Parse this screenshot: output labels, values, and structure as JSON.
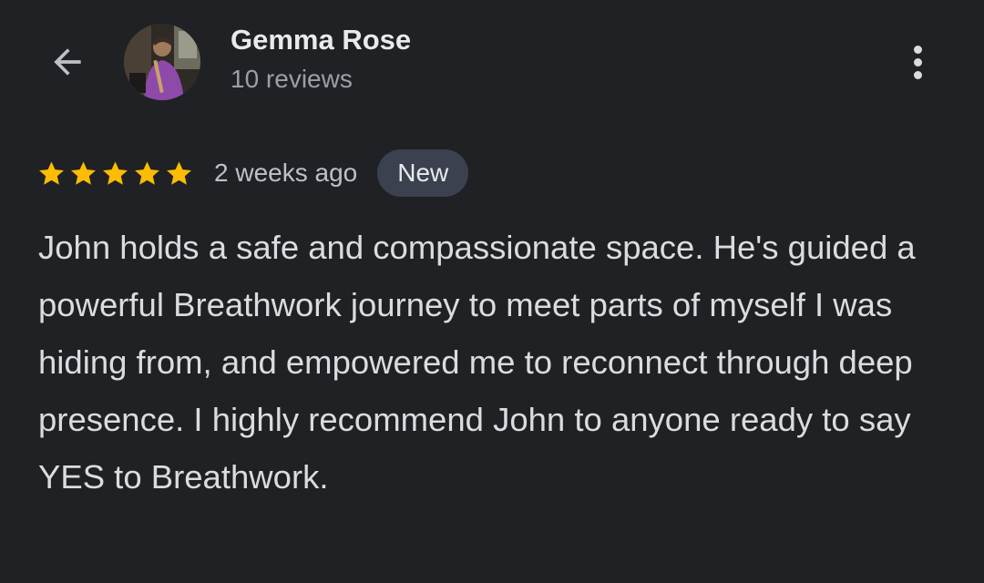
{
  "header": {
    "user_name": "Gemma Rose",
    "review_count": "10 reviews",
    "back_icon": "arrow-back-icon",
    "more_icon": "more-vert-icon"
  },
  "review": {
    "rating": 5,
    "max_rating": 5,
    "time_ago": "2 weeks ago",
    "badge": "New",
    "text": "John holds a safe and compassionate space. He's guided a powerful Breathwork journey to meet parts of myself I was hiding from, and empowered me to reconnect through deep presence. I highly recommend John to anyone ready to say YES to Breathwork."
  },
  "colors": {
    "background": "#202124",
    "star": "#fbbc04",
    "badge_bg": "#3c4150",
    "primary_text": "#e8eaed",
    "secondary_text": "#9aa0a6"
  }
}
